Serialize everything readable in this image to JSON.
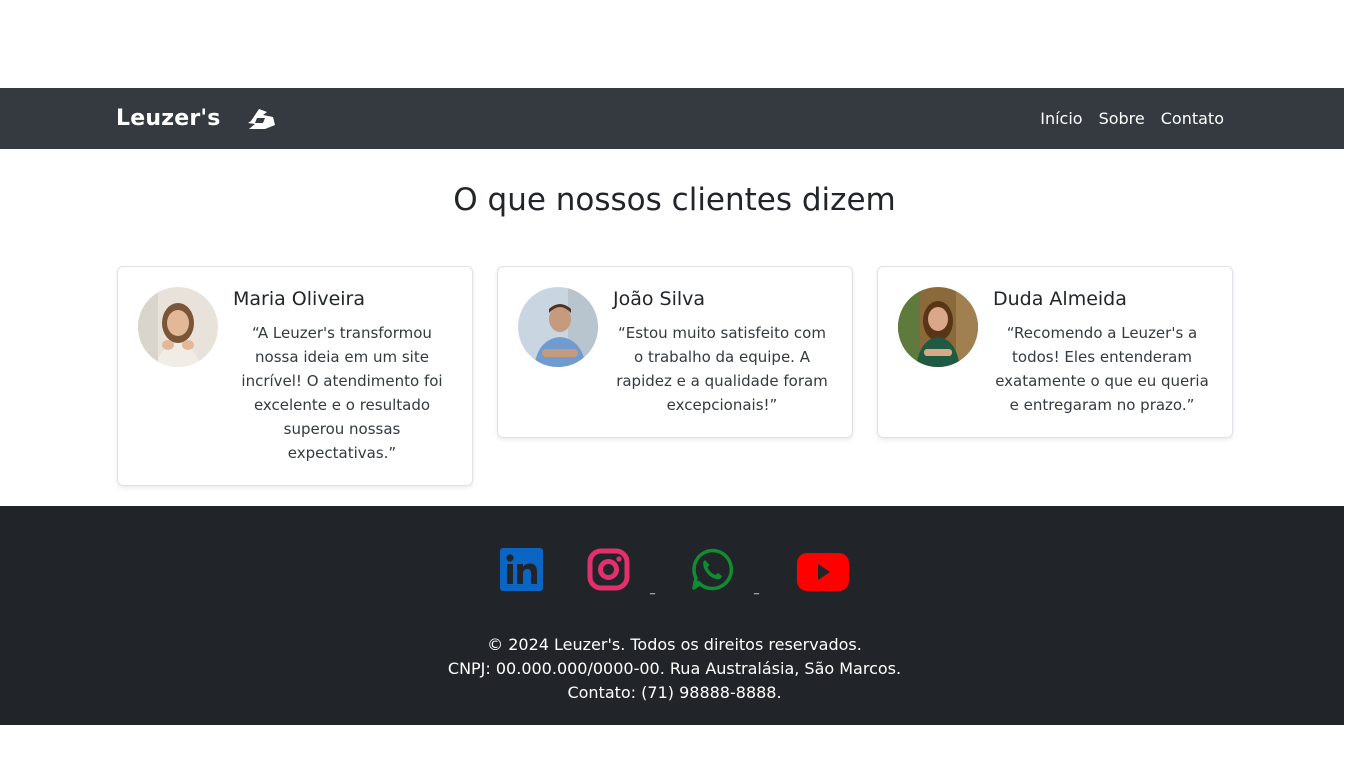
{
  "navbar": {
    "brand": "Leuzer's",
    "links": [
      "Início",
      "Sobre",
      "Contato"
    ]
  },
  "testimonials": {
    "title": "O que nossos clientes dizem",
    "items": [
      {
        "name": "Maria Oliveira",
        "quote": "“A Leuzer's transformou nossa ideia em um site incrível! O atendimento foi excelente e o resultado superou nossas expectativas.”"
      },
      {
        "name": "João Silva",
        "quote": "“Estou muito satisfeito com o trabalho da equipe. A rapidez e a qualidade foram excepcionais!”"
      },
      {
        "name": "Duda Almeida",
        "quote": "“Recomendo a Leuzer's a todos! Eles entenderam exatamente o que eu queria e entregaram no prazo.”"
      }
    ]
  },
  "footer": {
    "social": [
      "linkedin-icon",
      "instagram-icon",
      "whatsapp-icon",
      "youtube-icon"
    ],
    "copyright": "© 2024 Leuzer's. Todos os direitos reservados.",
    "address": "CNPJ: 00.000.000/0000-00. Rua Australásia, São Marcos.",
    "contact": "Contato: (71) 98888-8888."
  },
  "colors": {
    "navbar": "#343a40",
    "footer": "#212529",
    "linkedin": "#0a66c2",
    "instagram": "#e1306c",
    "whatsapp": "#128c32",
    "youtube": "#ff0000"
  }
}
